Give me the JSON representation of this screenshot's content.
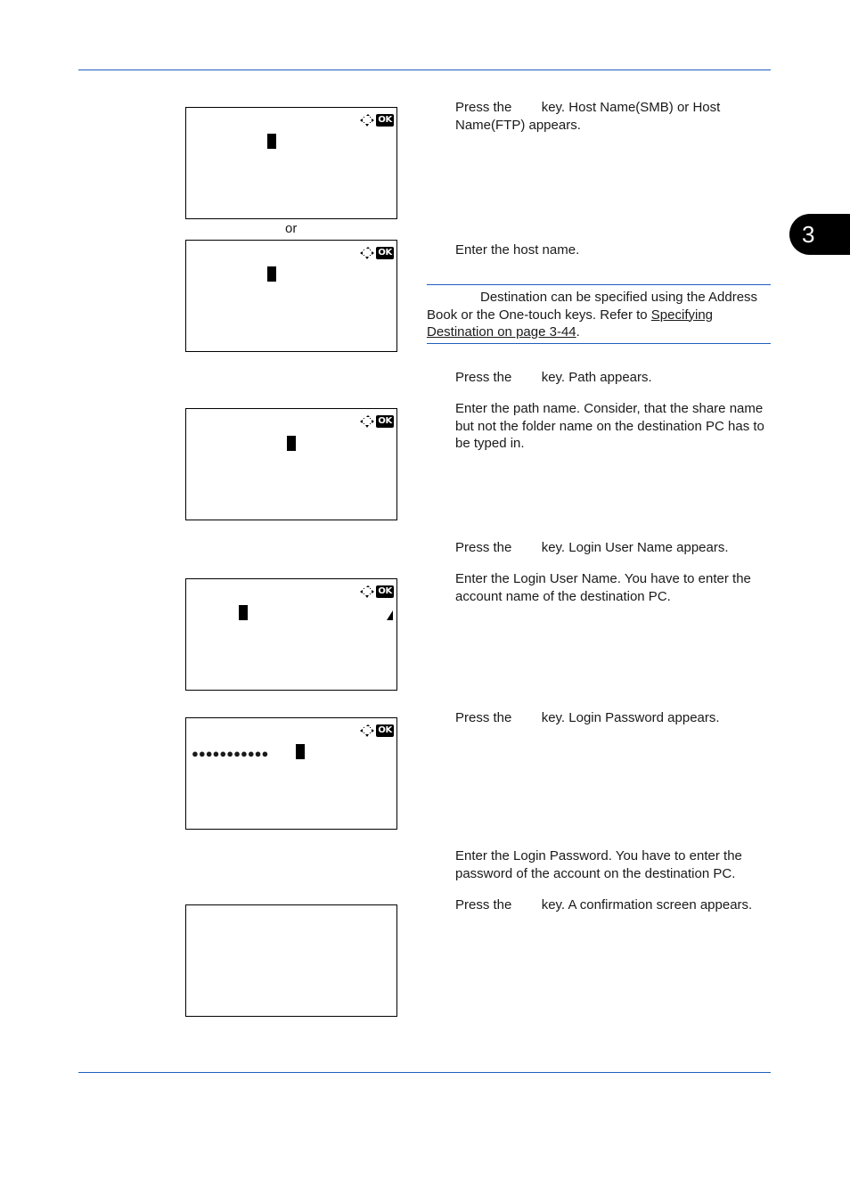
{
  "chapter": {
    "number": "3"
  },
  "captions": {
    "or": "or"
  },
  "screens": [
    {
      "id": "host-name-smb",
      "cursor": true,
      "nav_icon": "nav-cross-icon",
      "ok_label": "OK"
    },
    {
      "id": "host-name-ftp",
      "cursor": true,
      "nav_icon": "nav-cross-icon",
      "ok_label": "OK"
    },
    {
      "id": "path",
      "cursor": true,
      "nav_icon": "nav-cross-icon",
      "ok_label": "OK"
    },
    {
      "id": "login-user-name",
      "cursor": true,
      "nav_icon": "nav-cross-icon",
      "ok_label": "OK",
      "scroll_indicator": "triangle-icon"
    },
    {
      "id": "login-password",
      "cursor": true,
      "nav_icon": "nav-cross-icon",
      "ok_label": "OK",
      "masked_value": "●●●●●●●●●●●"
    },
    {
      "id": "confirmation",
      "cursor": false
    }
  ],
  "steps": [
    {
      "text": "Press the        key. Host Name(SMB) or Host Name(FTP) appears."
    },
    {
      "text": "Enter the host name."
    },
    {
      "text": "Press the        key. Path appears."
    },
    {
      "text": "Enter the path name. Consider, that the share name but not the folder name on the destination PC has to be typed in."
    },
    {
      "text": "Press the        key. Login User Name appears."
    },
    {
      "text": "Enter the Login User Name. You have to enter the account name of the destination PC."
    },
    {
      "text": "Press the        key. Login Password appears."
    },
    {
      "text": "Enter the Login Password. You have to enter the password of the account on the destination PC."
    },
    {
      "text": "Press the        key. A confirmation screen appears."
    }
  ],
  "note": {
    "text": "Destination can be specified using the Address Book or the One-touch keys. Refer to ",
    "link": "Specifying Destination on page 3-44",
    "suffix": "."
  },
  "colors": {
    "rule": "#1f5fbf",
    "tab": "#000000"
  }
}
